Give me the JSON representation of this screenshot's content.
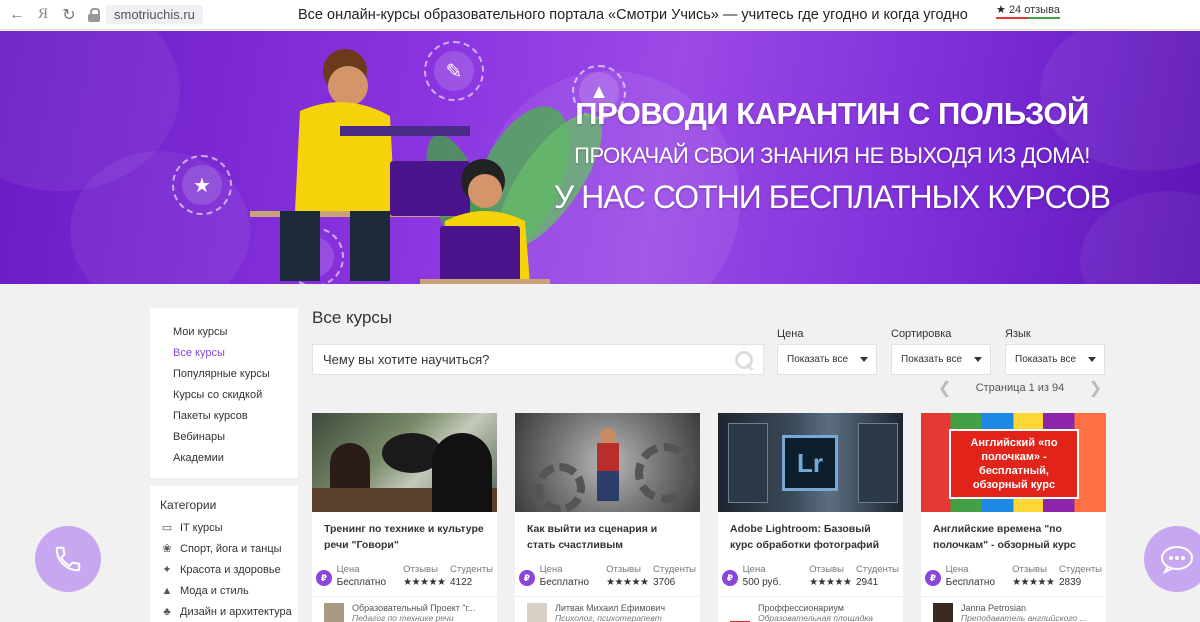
{
  "browser": {
    "url": "smotriuchis.ru",
    "yandex": "Я",
    "title": "Все онлайн-курсы образовательного портала «Смотри Учись» — учитесь где угодно и когда угодно",
    "reviews_star": "★",
    "reviews": "24 отзыва"
  },
  "banner": {
    "headline": "ПРОВОДИ КАРАНТИН С ПОЛЬЗОЙ",
    "subline": "ПРОКАЧАЙ СВОИ ЗНАНИЯ НЕ ВЫХОДЯ ИЗ ДОМА!",
    "subline2": "У НАС СОТНИ БЕСПЛАТНЫХ КУРСОВ"
  },
  "sidebar": {
    "items": [
      {
        "label": "Мои курсы"
      },
      {
        "label": "Все курсы"
      },
      {
        "label": "Популярные курсы"
      },
      {
        "label": "Курсы со скидкой"
      },
      {
        "label": "Пакеты курсов"
      },
      {
        "label": "Вебинары"
      },
      {
        "label": "Академии"
      }
    ],
    "active_index": 1
  },
  "categories": {
    "title": "Категории",
    "items": [
      {
        "label": "IT курсы"
      },
      {
        "label": "Спорт, йога и танцы"
      },
      {
        "label": "Красота и здоровье"
      },
      {
        "label": "Мода и стиль"
      },
      {
        "label": "Дизайн и архитектура"
      }
    ]
  },
  "main": {
    "title": "Все курсы",
    "search_placeholder": "Чему вы хотите научиться?"
  },
  "filters": {
    "price": {
      "label": "Цена",
      "value": "Показать все"
    },
    "sort": {
      "label": "Сортировка",
      "value": "Показать все"
    },
    "lang": {
      "label": "Язык",
      "value": "Показать все"
    }
  },
  "pager": {
    "text": "Страница 1 из 94"
  },
  "card_labels": {
    "price": "Цена",
    "reviews": "Отзывы",
    "students": "Студенты"
  },
  "cards": [
    {
      "title": "Тренинг по технике и культуре речи \"Говори\"",
      "price": "Бесплатно",
      "rating": 5,
      "students": "4122",
      "author": "Образовательный Проект \"г...",
      "role": "Педагог по технике речи"
    },
    {
      "title": "Как выйти из сценария и стать счастливым",
      "price": "Бесплатно",
      "rating": 5,
      "students": "3706",
      "author": "Литвак Михаил Ефимович",
      "role": "Психолог, психотерапевт"
    },
    {
      "title": "Adobe Lightroom: Базовый курс обработки фотографий",
      "price": "500 руб.",
      "rating": 5,
      "students": "2941",
      "author": "Проффессионариум",
      "role": "Образовательная площадка"
    },
    {
      "title": "Английские времена \"по полочкам\" - обзорный курс",
      "price": "Бесплатно",
      "rating": 5,
      "students": "2839",
      "author": "Janna Petrosian",
      "role": "Преподаватель английского ...",
      "image_label": "Английский «по полочкам» - бесплатный, обзорный курс"
    }
  ],
  "colors": {
    "accent": "#8a46d9",
    "banner_start": "#6a1bc4",
    "banner_end": "#5c14b3",
    "fab": "#c7a7f0"
  },
  "icons": {
    "price": "₽",
    "lightroom": "Lr"
  }
}
